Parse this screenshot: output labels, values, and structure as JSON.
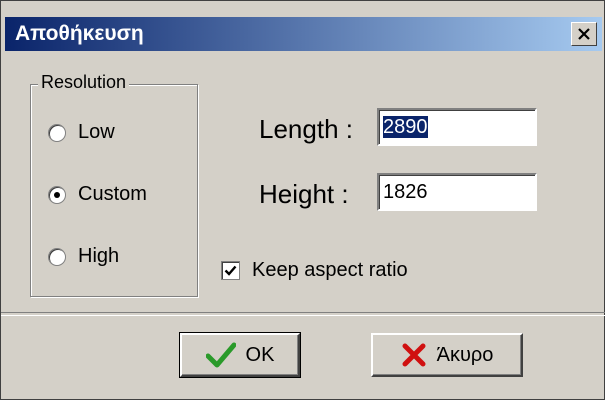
{
  "window": {
    "title": "Αποθήκευση"
  },
  "resolution_group": {
    "legend": "Resolution",
    "options": [
      {
        "label": "Low",
        "selected": false
      },
      {
        "label": "Custom",
        "selected": true
      },
      {
        "label": "High",
        "selected": false
      }
    ]
  },
  "size": {
    "length_label": "Length :",
    "length_value": "2890",
    "height_label": "Height :",
    "height_value": "1826"
  },
  "keep_aspect": {
    "label": "Keep aspect ratio",
    "checked": true
  },
  "buttons": {
    "ok": "OK",
    "cancel": "Άκυρο"
  },
  "icons": {
    "close": "close-icon",
    "ok": "green-checkmark-icon",
    "cancel": "red-x-icon"
  },
  "colors": {
    "title_start": "#0a246a",
    "title_end": "#a6caf0",
    "selection": "#0a246a",
    "ok_icon": "#2a9a2a",
    "cancel_icon": "#d01010"
  }
}
